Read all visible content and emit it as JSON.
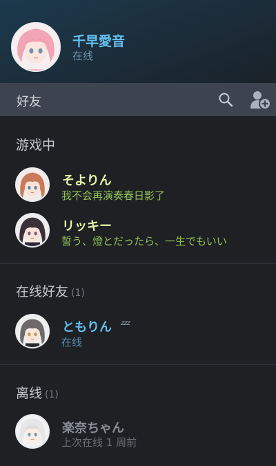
{
  "profile": {
    "name": "千早愛音",
    "status": "在线"
  },
  "friends_bar": {
    "title": "好友"
  },
  "sections": {
    "in_game": {
      "title": "游戏中",
      "friends": [
        {
          "name": "そよりん",
          "status": "我不会再演奏春日影了"
        },
        {
          "name": "リッキー",
          "status": "誓う、燈とだったら、一生でもいい"
        }
      ]
    },
    "online": {
      "title": "在线好友",
      "count": "(1)",
      "friends": [
        {
          "name": "ともりん",
          "status": "在线",
          "snooze": "zzz"
        }
      ]
    },
    "offline": {
      "title": "离线",
      "count": "(1)",
      "friends": [
        {
          "name": "楽奈ちゃん",
          "status": "上次在线 1 周前"
        }
      ]
    }
  },
  "colors": {
    "online_blue": "#66c2f4",
    "in_game_green": "#91c257",
    "offline_gray": "#8a8f96"
  },
  "icons": [
    "search-icon",
    "add-friend-icon"
  ]
}
